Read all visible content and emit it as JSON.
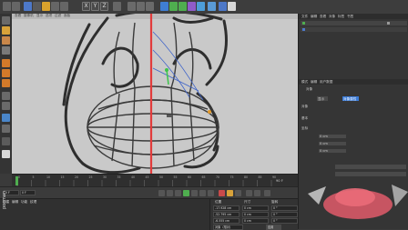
{
  "toolbar": {
    "axis_x_label": "X",
    "axis_y_label": "Y",
    "axis_z_label": "Z"
  },
  "viewport": {
    "menu_items": [
      "查看",
      "摄像机",
      "显示",
      "选项",
      "过滤",
      "面板"
    ]
  },
  "right_panel": {
    "top_menu": [
      "文件",
      "编辑",
      "查看",
      "对象",
      "标签",
      "书签"
    ],
    "attr_tabs": [
      "模式",
      "编辑",
      "用户数据"
    ],
    "section_label": "对象",
    "section_label2": "坐标",
    "fields": [
      "对象",
      "基本",
      "坐标"
    ],
    "buttons": [
      "对象属性",
      "显示"
    ],
    "values": [
      "0 cm",
      "0 cm",
      "0 cm"
    ]
  },
  "timeline": {
    "ticks": [
      "0",
      "5",
      "10",
      "15",
      "20",
      "25",
      "30",
      "35",
      "40",
      "45",
      "50",
      "55",
      "60",
      "65",
      "70",
      "75",
      "80",
      "85",
      "90"
    ],
    "frame_end": "90 F"
  },
  "bottom": {
    "tabs": [
      "创建",
      "编辑",
      "功能",
      "纹理"
    ],
    "coord_tabs": [
      "位置",
      "尺寸",
      "旋转"
    ],
    "coord_values": [
      "-17.928 cm",
      "0 cm",
      "0 °",
      "-52.795 cm",
      "0 cm",
      "0 °",
      "-6.555 cm",
      "0 cm",
      "0 °"
    ],
    "apply_button": "应用",
    "object_mode": "对象（相对）"
  },
  "watermark": "pocman",
  "colors": {
    "viewport_bg": "#c9c9c9",
    "axis_red": "#e23b3b",
    "wire_blue": "#3d63c9",
    "wire_green": "#3cc44a",
    "highlight_blue": "#3a7ad6"
  }
}
